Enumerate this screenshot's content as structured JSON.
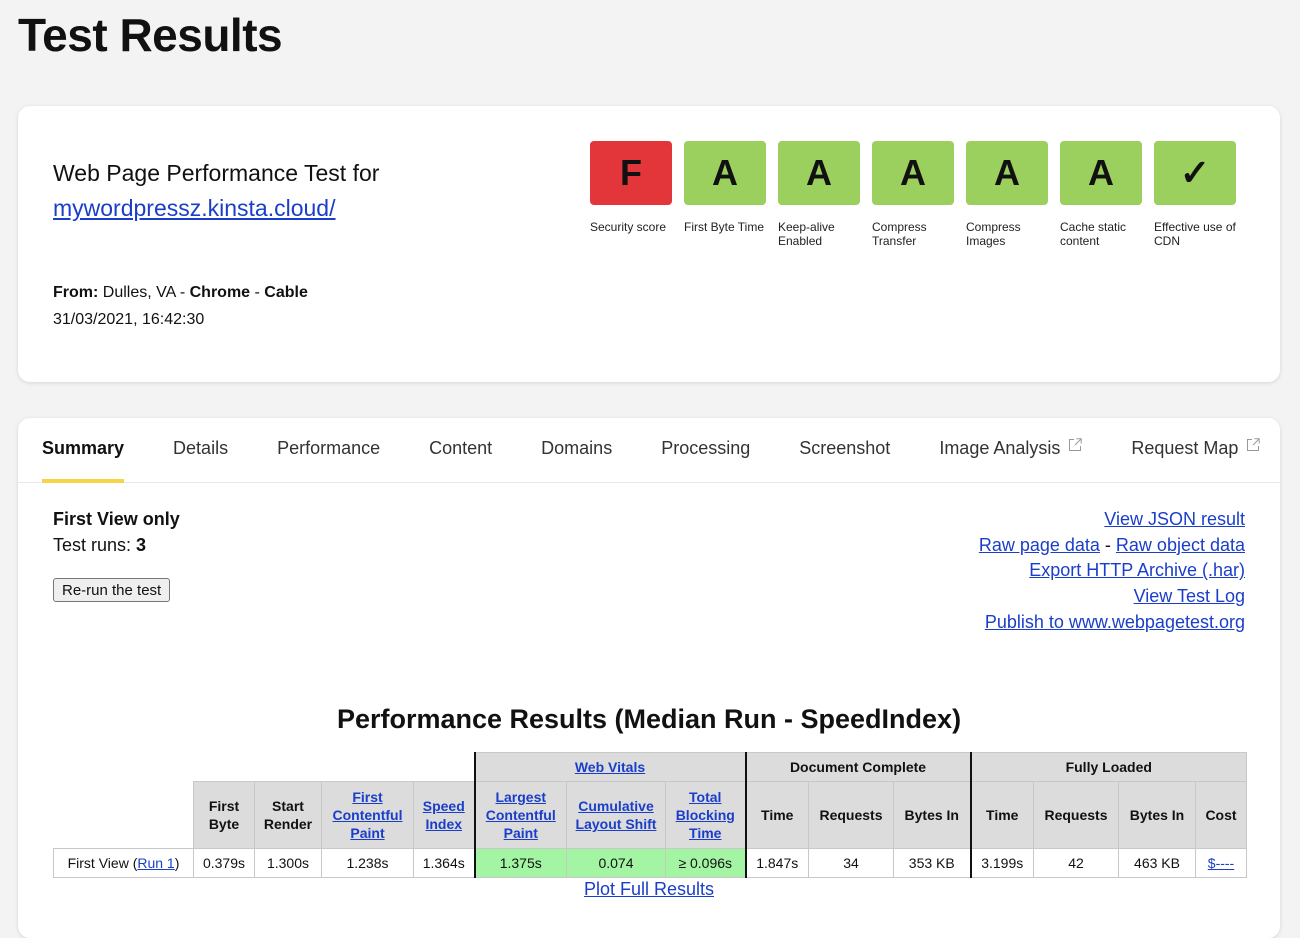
{
  "page": {
    "title": "Test Results"
  },
  "summary_card": {
    "test_for_label": "Web Page Performance Test for",
    "url": "mywordpressz.kinsta.cloud/",
    "from_label": "From:",
    "location": "Dulles, VA",
    "separator": " - ",
    "browser": "Chrome",
    "connection": "Cable",
    "datetime": "31/03/2021, 16:42:30",
    "grades": [
      {
        "grade": "F",
        "label": "Security score",
        "color": "#e3363a"
      },
      {
        "grade": "A",
        "label": "First Byte Time",
        "color": "#9bd05e"
      },
      {
        "grade": "A",
        "label": "Keep-alive Enabled",
        "color": "#9bd05e"
      },
      {
        "grade": "A",
        "label": "Compress Transfer",
        "color": "#9bd05e"
      },
      {
        "grade": "A",
        "label": "Compress Images",
        "color": "#9bd05e"
      },
      {
        "grade": "A",
        "label": "Cache static content",
        "color": "#9bd05e"
      },
      {
        "grade": "✓",
        "label": "Effective use of CDN",
        "color": "#9bd05e"
      }
    ]
  },
  "tabs": [
    {
      "label": "Summary",
      "active": true
    },
    {
      "label": "Details"
    },
    {
      "label": "Performance"
    },
    {
      "label": "Content"
    },
    {
      "label": "Domains"
    },
    {
      "label": "Processing"
    },
    {
      "label": "Screenshot"
    },
    {
      "label": "Image Analysis",
      "icon": "external-link-icon"
    },
    {
      "label": "Request Map",
      "icon": "external-link-icon"
    }
  ],
  "summary": {
    "view_mode": "First View only",
    "runs_label": "Test runs: ",
    "runs_value": "3",
    "rerun_button": "Re-run the test",
    "links": {
      "view_json": "View JSON result",
      "raw_page": "Raw page data",
      "dash": " - ",
      "raw_object": "Raw object data",
      "export_har": "Export HTTP Archive (.har)",
      "view_log": "View Test Log",
      "publish": "Publish to www.webpagetest.org"
    }
  },
  "results": {
    "title": "Performance Results (Median Run - SpeedIndex)",
    "groups": {
      "web_vitals": "Web Vitals",
      "document_complete": "Document Complete",
      "fully_loaded": "Fully Loaded"
    },
    "headers": {
      "first_byte": "First Byte",
      "start_render": "Start Render",
      "fcp": "First Contentful Paint",
      "speed_index": "Speed Index",
      "lcp": "Largest Contentful Paint",
      "cls": "Cumulative Layout Shift",
      "tbt": "Total Blocking Time",
      "dc_time": "Time",
      "dc_requests": "Requests",
      "dc_bytes": "Bytes In",
      "fl_time": "Time",
      "fl_requests": "Requests",
      "fl_bytes": "Bytes In",
      "cost": "Cost"
    },
    "row": {
      "label_prefix": "First View (",
      "run_link": "Run 1",
      "label_suffix": ")",
      "first_byte": "0.379s",
      "start_render": "1.300s",
      "fcp": "1.238s",
      "speed_index": "1.364s",
      "lcp": "1.375s",
      "cls": "0.074",
      "tbt": "≥ 0.096s",
      "dc_time": "1.847s",
      "dc_requests": "34",
      "dc_bytes": "353 KB",
      "fl_time": "3.199s",
      "fl_requests": "42",
      "fl_bytes": "463 KB",
      "cost": "$----"
    },
    "plot_link": "Plot Full Results"
  }
}
